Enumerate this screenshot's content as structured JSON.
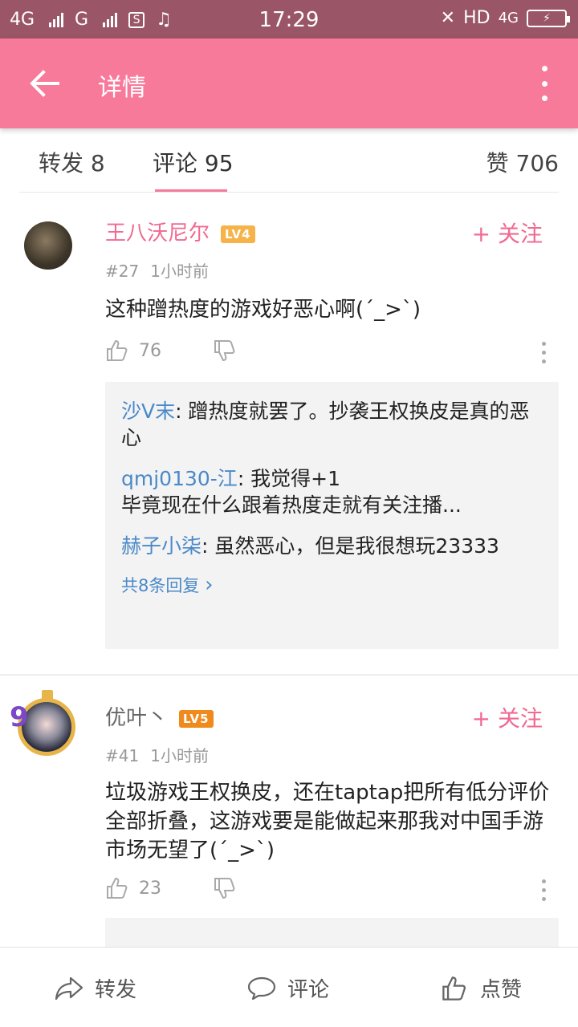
{
  "status_bar": {
    "left_network": "4G",
    "left_network2": "G",
    "time": "17:29",
    "hd": "HD",
    "right_network": "4G"
  },
  "app_bar": {
    "title": "详情",
    "back_icon": "arrow-left-icon",
    "more_icon": "more-vertical-icon"
  },
  "tabs": {
    "repost": "转发 8",
    "comments": "评论 95",
    "likes": "赞 706",
    "active": "comments"
  },
  "comments": [
    {
      "user": "王八沃尼尔",
      "level": "LV4",
      "level_color": "#f5a623",
      "name_color": "#f06a92",
      "follow": "+ 关注",
      "floor": "#27",
      "time": "1小时前",
      "text": "这种蹭热度的游戏好恶心啊(ˊ_>ˋ)",
      "likes": "76",
      "replies": [
        {
          "user": "沙V末",
          "text": ": 蹭热度就罢了。抄袭王权换皮是真的恶心"
        },
        {
          "user": "qmj0130-江",
          "text": ": 我觉得+1\n毕竟现在什么跟着热度走就有关注播..."
        },
        {
          "user": "赫子小柒",
          "text": ": 虽然恶心，但是我很想玩23333"
        }
      ],
      "more_replies": "共8条回复"
    },
    {
      "user": "优叶丶",
      "level": "LV5",
      "level_color": "#f08a1c",
      "name_color": "#666666",
      "follow": "+ 关注",
      "floor": "#41",
      "time": "1小时前",
      "text": "垃圾游戏王权换皮，还在taptap把所有低分评价全部折叠，这游戏要是能做起来那我对中国手游市场无望了(ˊ_>ˋ)",
      "likes": "23",
      "partial_reply": "​"
    }
  ],
  "bottom_bar": {
    "repost": "转发",
    "comment": "评论",
    "like": "点赞"
  },
  "colors": {
    "accent": "#f77a9b",
    "status_bar": "#9a5566",
    "link_blue": "#4a89c9"
  }
}
